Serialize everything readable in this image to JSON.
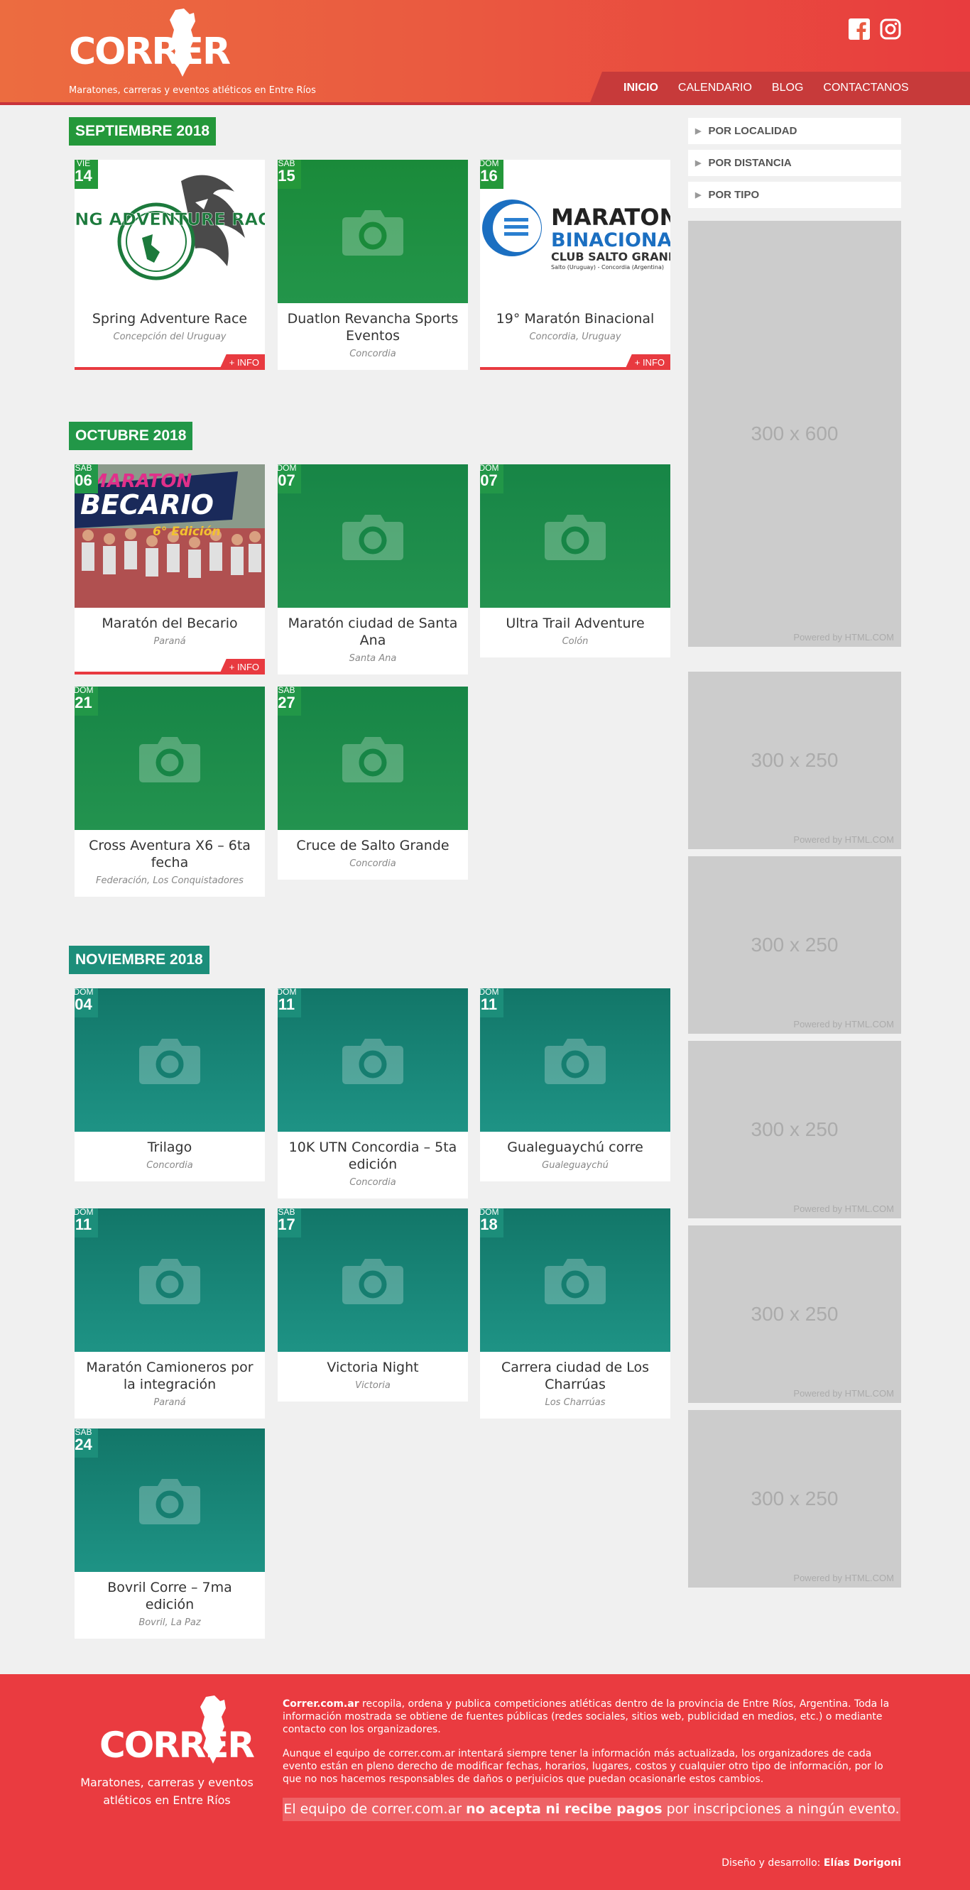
{
  "header": {
    "logo_text": "CORRER",
    "tagline": "Maratones, carreras y eventos atléticos en Entre Ríos",
    "nav": [
      "INICIO",
      "CALENDARIO",
      "BLOG",
      "CONTACTANOS"
    ]
  },
  "months": [
    {
      "name": "SEPTIEMBRE 2018",
      "color": "#24983a",
      "events": [
        {
          "dow": "VIE",
          "day": "14",
          "title": "Spring Adventure Race",
          "place": "Concepción del Uruguay",
          "info": "+ INFO",
          "logo": "SPRING ADVENTURE RACE"
        },
        {
          "dow": "SAB",
          "day": "15",
          "title": "Duatlon Revancha Sports Eventos",
          "place": "Concordia"
        },
        {
          "dow": "DOM",
          "day": "16",
          "title": "19° Maratón Binacional",
          "place": "Concordia, Uruguay",
          "info": "+ INFO",
          "logo1": "MARATON",
          "logo2": "BINACIONAL",
          "logo3": "CLUB SALTO GRANDE",
          "logo4": "Salto (Uruguay) - Concordia (Argentina)"
        }
      ]
    },
    {
      "name": "OCTUBRE 2018",
      "color": "#229748",
      "events": [
        {
          "dow": "SAB",
          "day": "06",
          "title": "Maratón del Becario",
          "place": "Paraná",
          "info": "+ INFO",
          "logo1": "MARATON",
          "logo2": "BECARIO",
          "logo3": "6° Edición"
        },
        {
          "dow": "DOM",
          "day": "07",
          "title": "Maratón ciudad de Santa Ana",
          "place": "Santa Ana"
        },
        {
          "dow": "DOM",
          "day": "07",
          "title": "Ultra Trail Adventure",
          "place": "Colón"
        },
        {
          "dow": "DOM",
          "day": "21",
          "title": "Cross Aventura X6 – 6ta fecha",
          "place": "Federación, Los Conquistadores"
        },
        {
          "dow": "SAB",
          "day": "27",
          "title": "Cruce de Salto Grande",
          "place": "Concordia"
        }
      ]
    },
    {
      "name": "NOVIEMBRE 2018",
      "color": "#1c8e7a",
      "events": [
        {
          "dow": "DOM",
          "day": "04",
          "title": "Trilago",
          "place": "Concordia"
        },
        {
          "dow": "DOM",
          "day": "11",
          "title": "10K UTN Concordia – 5ta edición",
          "place": "Concordia"
        },
        {
          "dow": "DOM",
          "day": "11",
          "title": "Gualeguaychú corre",
          "place": "Gualeguaychú"
        },
        {
          "dow": "DOM",
          "day": "11",
          "title": "Maratón Camioneros por la integración",
          "place": "Paraná"
        },
        {
          "dow": "SAB",
          "day": "17",
          "title": "Victoria Night",
          "place": "Victoria"
        },
        {
          "dow": "DOM",
          "day": "18",
          "title": "Carrera ciudad de Los Charrúas",
          "place": "Los Charrúas"
        },
        {
          "dow": "SAB",
          "day": "24",
          "title": "Bovril Corre – 7ma edición",
          "place": "Bovril, La Paz"
        }
      ]
    }
  ],
  "sidebar": {
    "filters": [
      "POR LOCALIDAD",
      "POR DISTANCIA",
      "POR TIPO"
    ],
    "ads": [
      {
        "size": "300 x 600",
        "powered": "Powered by HTML.COM"
      },
      {
        "size": "300 x 250",
        "powered": "Powered by HTML.COM"
      },
      {
        "size": "300 x 250",
        "powered": "Powered by HTML.COM"
      },
      {
        "size": "300 x 250",
        "powered": "Powered by HTML.COM"
      },
      {
        "size": "300 x 250",
        "powered": "Powered by HTML.COM"
      },
      {
        "size": "300 x 250",
        "powered": "Powered by HTML.COM"
      }
    ]
  },
  "footer": {
    "logo_text": "CORRER",
    "tagline": "Maratones, carreras y eventos atléticos en Entre Ríos",
    "p1_bold": "Correr.com.ar",
    "p1": " recopila, ordena y publica competiciones atléticas dentro de la provincia de Entre Ríos, Argentina. Toda la información mostrada se obtiene de fuentes públicas (redes sociales, sitios web, publicidad en medios, etc.) o mediante contacto con los organizadores.",
    "p2": "Aunque el equipo de correr.com.ar intentará siempre tener la información más actualizada, los organizadores de cada evento están en pleno derecho de modificar fechas, horarios, lugares, costos y cualquier otro tipo de información, por lo que no nos hacemos responsables de daños o perjuicios que puedan ocasionarle estos cambios.",
    "notice_pre": "El equipo de correr.com.ar ",
    "notice_bold": "no acepta ni recibe pagos",
    "notice_post": " por inscripciones a ningún evento.",
    "credit_pre": "Diseño y desarrollo: ",
    "credit_name": "Elías Dorigoni"
  }
}
